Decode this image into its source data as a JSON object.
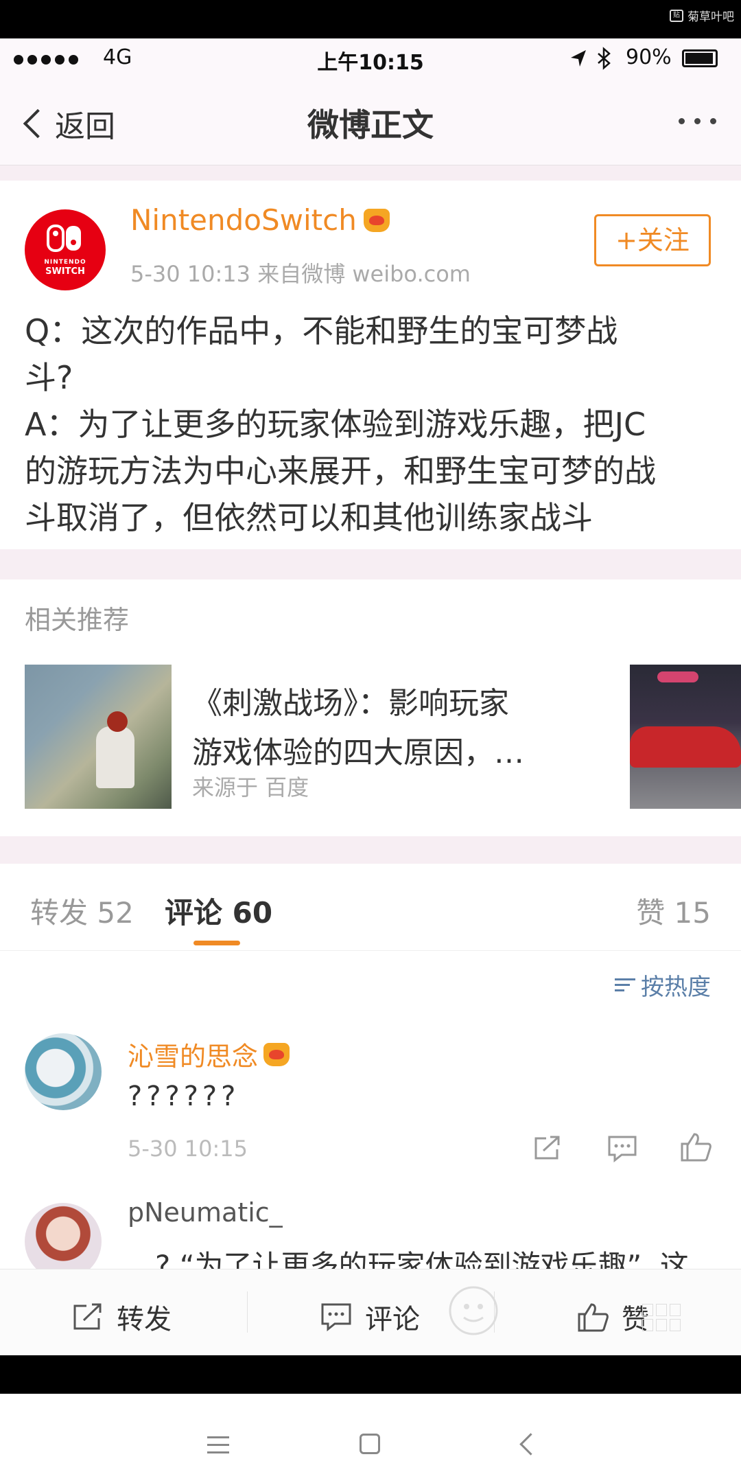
{
  "watermark": "菊草叶吧",
  "status_bar": {
    "carrier": "4G",
    "time": "上午10:15",
    "battery": "90%"
  },
  "nav": {
    "back_label": "返回",
    "title": "微博正文"
  },
  "post": {
    "author": "NintendoSwitch",
    "avatar_brand_line1": "NINTENDO",
    "avatar_brand_line2": "SWITCH",
    "meta": "5-30 10:13  来自微博 weibo.com",
    "follow_label": "+关注",
    "lines": [
      "Q：这次的作品中，不能和野生的宝可梦战",
      "斗?",
      "A：为了让更多的玩家体验到游戏乐趣，把JC",
      "的游玩方法为中心来展开，和野生宝可梦的战",
      "斗取消了，但依然可以和其他训练家战斗"
    ]
  },
  "related": {
    "title": "相关推荐",
    "item": {
      "line1": "《刺激战场》：影响玩家",
      "line2": "游戏体验的四大原因，…",
      "source": "来源于 百度"
    }
  },
  "tabs": {
    "repost": "转发 52",
    "comment": "评论 60",
    "like": "赞 15"
  },
  "sort_label": "按热度",
  "comments": [
    {
      "name": "沁雪的思念",
      "text": "??????",
      "time": "5-30 10:15"
    },
    {
      "name": "pNeumatic_",
      "text": "...? “为了让更多的玩家体验到游戏乐趣”, 这"
    }
  ],
  "actions": {
    "repost": "转发",
    "comment": "评论",
    "like": "赞"
  },
  "colors": {
    "accent": "#f08a24",
    "link": "#5b7fa8",
    "nintendo_red": "#e60012"
  }
}
